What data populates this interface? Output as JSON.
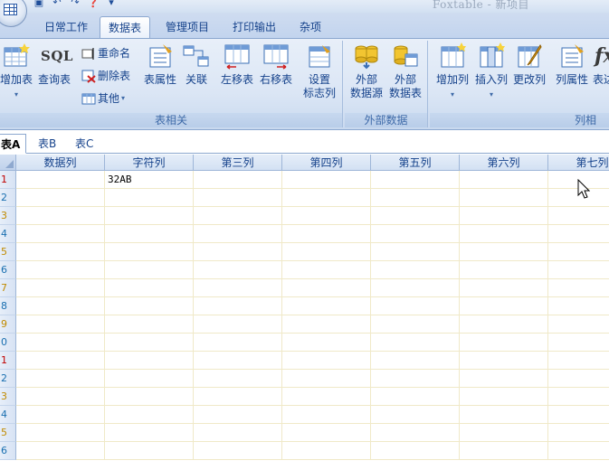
{
  "window": {
    "title": "Foxtable - 新项目",
    "quick_access": [
      "save-icon",
      "undo-icon",
      "redo-icon",
      "help-icon",
      "customize-icon"
    ]
  },
  "ribbon_tabs": [
    {
      "label": "日常工作",
      "active": false
    },
    {
      "label": "数据表",
      "active": true
    },
    {
      "label": "管理项目",
      "active": false
    },
    {
      "label": "打印输出",
      "active": false
    },
    {
      "label": "杂项",
      "active": false
    }
  ],
  "groups": {
    "table": {
      "label": "表相关",
      "add_table": "增加表",
      "query_table": "查询表",
      "sql_icon_text": "SQL",
      "rename": "重命名",
      "delete_table": "删除表",
      "other": "其他",
      "table_props": "表属性",
      "relation": "关联",
      "move_left": "左移表",
      "move_right": "右移表",
      "set_flag_col_1": "设置",
      "set_flag_col_2": "标志列"
    },
    "external": {
      "label": "外部数据",
      "ext_source_1": "外部",
      "ext_source_2": "数据源",
      "ext_table_1": "外部",
      "ext_table_2": "数据表"
    },
    "columns": {
      "label": "列相",
      "add_col": "增加列",
      "insert_col": "插入列",
      "change_col": "更改列",
      "col_props": "列属性",
      "expr_col": "表达",
      "fx_icon_text": "fx"
    }
  },
  "sheet_tabs": [
    {
      "label": "表A",
      "active": true
    },
    {
      "label": "表B",
      "active": false
    },
    {
      "label": "表C",
      "active": false
    }
  ],
  "grid": {
    "columns": [
      "数据列",
      "字符列",
      "第三列",
      "第四列",
      "第五列",
      "第六列",
      "第七列"
    ],
    "row_numbers": [
      "1",
      "2",
      "3",
      "4",
      "5",
      "6",
      "7",
      "8",
      "9",
      "0",
      "1",
      "2",
      "3",
      "4",
      "5",
      "6"
    ],
    "row_number_colors": [
      "#c00000",
      "#1a6fb0",
      "#c08a00",
      "#1a6fb0",
      "#c08a00",
      "#1a6fb0",
      "#c08a00",
      "#1a6fb0",
      "#c08a00",
      "#1a6fb0",
      "#c00000",
      "#1a6fb0",
      "#c08a00",
      "#1a6fb0",
      "#c08a00",
      "#1a6fb0"
    ],
    "rows": [
      [
        "",
        "32AB",
        "",
        "",
        "",
        "",
        ""
      ]
    ]
  },
  "colors": {
    "ribbon_text": "#15428b",
    "grid_line": "#f0e9c8"
  }
}
